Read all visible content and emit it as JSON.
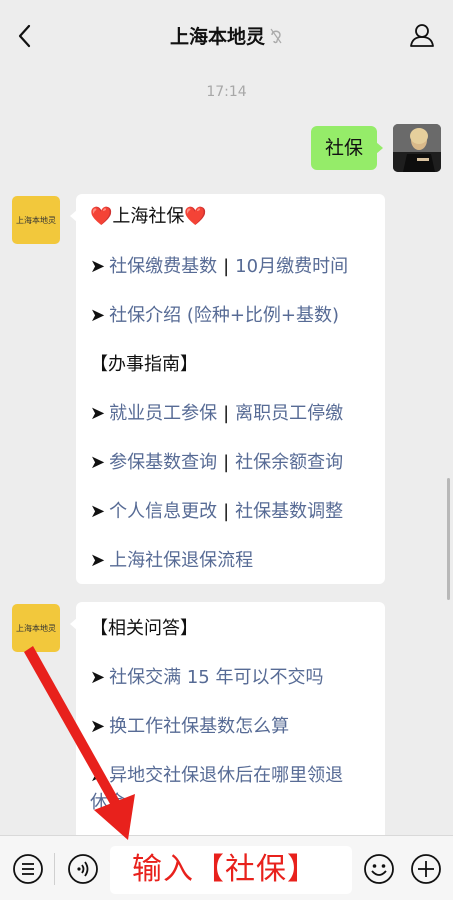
{
  "header": {
    "title": "上海本地灵"
  },
  "timestamp": "17:14",
  "my_message": "社保",
  "bot_avatar_label": "上海本地灵",
  "msg1": {
    "title_left": "❤️",
    "title_text": "上海社保",
    "title_right": "❤️",
    "row1": {
      "a": "社保缴费基数",
      "b": "10月缴费时间"
    },
    "row2": {
      "a": "社保介绍 (险种+比例+基数)"
    },
    "section": "【办事指南】",
    "row3": {
      "a": "就业员工参保",
      "b": "离职员工停缴"
    },
    "row4": {
      "a": "参保基数查询",
      "b": "社保余额查询"
    },
    "row5": {
      "a": "个人信息更改",
      "b": "社保基数调整"
    },
    "row6": {
      "a": "上海社保退保流程"
    }
  },
  "msg2": {
    "section": "【相关问答】",
    "row1": "社保交满 15 年可以不交吗",
    "row2": "换工作社保基数怎么算",
    "row3_line1": "异地交社保退休后在哪里领退",
    "row3_line2": "休金"
  },
  "bottom": {
    "input_text": "输入【社保】"
  },
  "arrow_glyph": "➤",
  "separator": "|",
  "colors": {
    "link": "#576b95",
    "bubble_green": "#95ec69",
    "avatar_yellow": "#f2c83c",
    "annotation_red": "#e8211c"
  }
}
